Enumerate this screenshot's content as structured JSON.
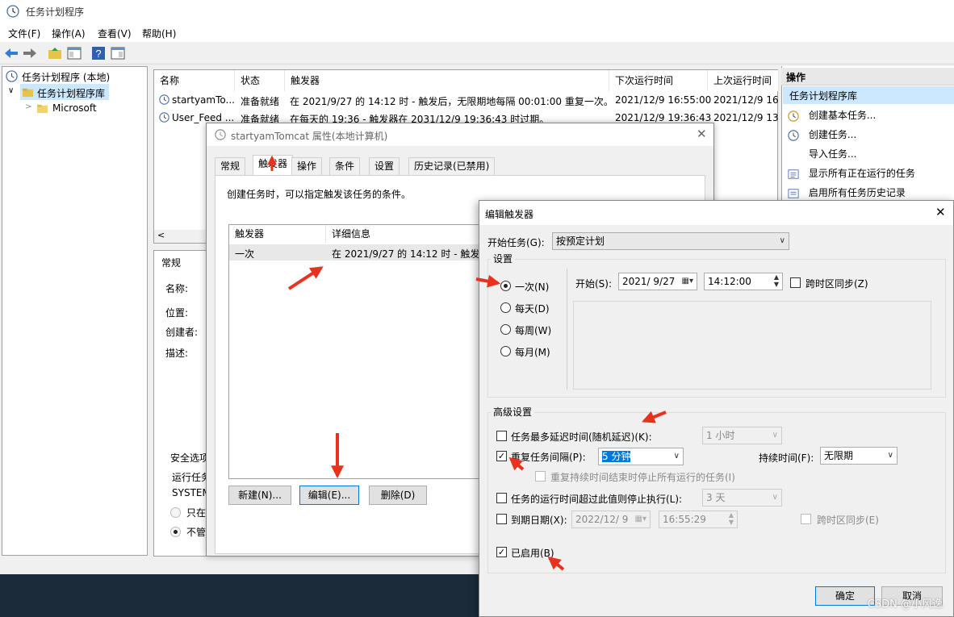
{
  "window": {
    "title": "任务计划程序"
  },
  "menu": [
    "文件(F)",
    "操作(A)",
    "查看(V)",
    "帮助(H)"
  ],
  "tree": {
    "root": "任务计划程序 (本地)",
    "library": "任务计划程序库",
    "child": "Microsoft"
  },
  "task_list": {
    "columns": [
      "名称",
      "状态",
      "触发器",
      "下次运行时间",
      "上次运行时间"
    ],
    "rows": [
      {
        "name": "startyamTo...",
        "status": "准备就绪",
        "trigger": "在 2021/9/27 的 14:12 时 - 触发后，无限期地每隔 00:01:00 重复一次。",
        "next": "2021/12/9 16:55:00",
        "last": "2021/12/9 16"
      },
      {
        "name": "User_Feed ...",
        "status": "准备就绪",
        "trigger": "在每天的 19:36 - 触发器在 2031/12/9 19:36:43 时过期。",
        "next": "2021/12/9 19:36:43",
        "last": "2021/12/9 13"
      }
    ]
  },
  "detail": {
    "tab": "常规",
    "labels": [
      "名称:",
      "位置:",
      "创建者:",
      "描述:"
    ],
    "security_label": "安全选项",
    "run_label": "运行任务",
    "system": "SYSTEM",
    "opt1": "只在",
    "opt2": "不管"
  },
  "actions": {
    "header": "操作",
    "selected": "任务计划程序库",
    "items": [
      "创建基本任务...",
      "创建任务...",
      "导入任务...",
      "显示所有正在运行的任务",
      "启用所有任务历史记录"
    ]
  },
  "props_dialog": {
    "title": "startyamTomcat 属性(本地计算机)",
    "tabs": [
      "常规",
      "触发器",
      "操作",
      "条件",
      "设置",
      "历史记录(已禁用)"
    ],
    "description": "创建任务时，可以指定触发该任务的条件。",
    "list_columns": [
      "触发器",
      "详细信息"
    ],
    "list_row": {
      "trigger": "一次",
      "detail": "在 2021/9/27 的 14:12 时 - 触发后"
    },
    "buttons": {
      "new": "新建(N)...",
      "edit": "编辑(E)...",
      "delete": "删除(D)"
    }
  },
  "edit_dialog": {
    "title": "编辑触发器",
    "start_task_label": "开始任务(G):",
    "start_task_value": "按预定计划",
    "settings_label": "设置",
    "schedule_options": [
      "一次(N)",
      "每天(D)",
      "每周(W)",
      "每月(M)"
    ],
    "start_label": "开始(S):",
    "start_date": "2021/ 9/27",
    "start_time": "14:12:00",
    "sync_tz": "跨时区同步(Z)",
    "advanced_label": "高级设置",
    "delay_label": "任务最多延迟时间(随机延迟)(K):",
    "delay_value": "1 小时",
    "repeat_label": "重复任务间隔(P):",
    "repeat_value": "5 分钟",
    "duration_label": "持续时间(F):",
    "duration_value": "无限期",
    "stop_repeat_label": "重复持续时间结束时停止所有运行的任务(I)",
    "stop_longer_label": "任务的运行时间超过此值则停止执行(L):",
    "stop_longer_value": "3 天",
    "expire_label": "到期日期(X):",
    "expire_date": "2022/12/ 9",
    "expire_time": "16:55:29",
    "expire_sync": "跨时区同步(E)",
    "enabled_label": "已启用(B)",
    "ok": "确定",
    "cancel": "取消"
  },
  "watermark": "CSDN @小风逸",
  "colors": {
    "selection": "#cce8ff",
    "accent": "#0078d7",
    "arrow": "#e8321e"
  }
}
